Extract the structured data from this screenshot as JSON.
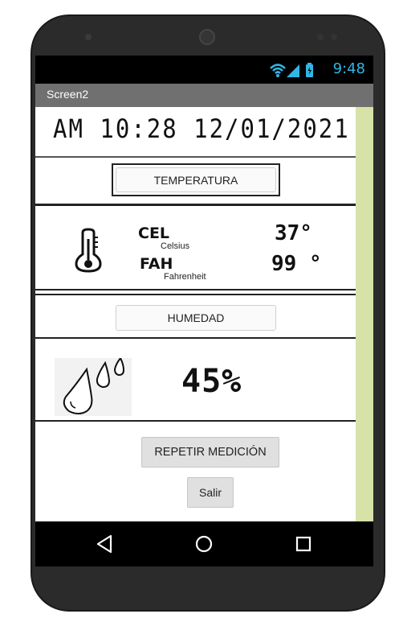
{
  "statusbar": {
    "time": "9:48",
    "icons": [
      "wifi-icon",
      "signal-icon",
      "battery-icon"
    ]
  },
  "app": {
    "title": "Screen2"
  },
  "clock": {
    "text": "AM 10:28 12/01/2021"
  },
  "temperature": {
    "button_label": "TEMPERATURA",
    "celsius_abbr": "CEL",
    "celsius_name": "Celsius",
    "celsius_value": "37°",
    "fahrenheit_abbr": "FAH",
    "fahrenheit_name": "Fahrenheit",
    "fahrenheit_value": "99 °"
  },
  "humidity": {
    "button_label": "HUMEDAD",
    "value": "45%"
  },
  "actions": {
    "repeat_label": "REPETIR MEDICIÓN",
    "exit_label": "Salir"
  },
  "colors": {
    "status_accent": "#33b5e5",
    "title_bar": "#707070",
    "side_panel": "#d6e2a8"
  }
}
